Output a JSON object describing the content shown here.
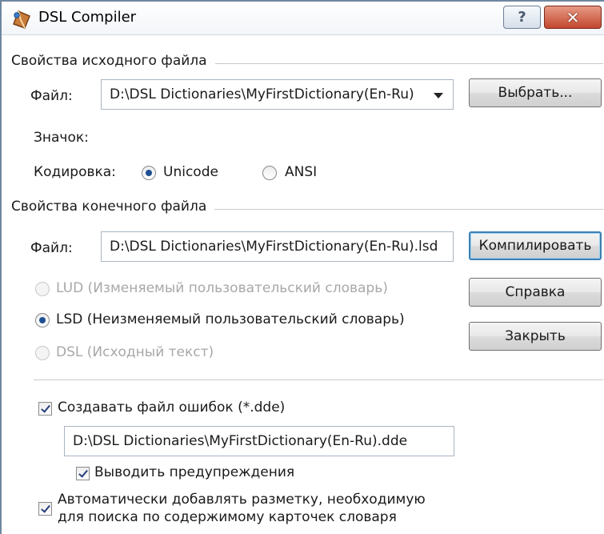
{
  "window": {
    "title": "DSL Compiler",
    "help_label": "?",
    "close_label": "✕"
  },
  "source": {
    "group_title": "Свойства исходного файла",
    "file_label": "Файл:",
    "file_value": "D:\\DSL Dictionaries\\MyFirstDictionary(En-Ru)",
    "browse_label": "Выбрать...",
    "icon_label": "Значок:",
    "encoding_label": "Кодировка:",
    "encoding_options": [
      "Unicode",
      "ANSI"
    ],
    "encoding_selected": "Unicode"
  },
  "target": {
    "group_title": "Свойства конечного файла",
    "file_label": "Файл:",
    "file_value": "D:\\DSL Dictionaries\\MyFirstDictionary(En-Ru).lsd",
    "formats": [
      {
        "label": "LUD (Изменяемый пользовательский словарь)",
        "enabled": false,
        "checked": false
      },
      {
        "label": "LSD (Неизменяемый пользовательский словарь)",
        "enabled": true,
        "checked": true
      },
      {
        "label": "DSL (Исходный текст)",
        "enabled": false,
        "checked": false
      }
    ]
  },
  "buttons": {
    "compile": "Компилировать",
    "help": "Справка",
    "close": "Закрыть"
  },
  "errors": {
    "create_label": "Создавать файл ошибок (*.dde)",
    "create_checked": true,
    "file_value": "D:\\DSL Dictionaries\\MyFirstDictionary(En-Ru).dde",
    "warnings_label": "Выводить предупреждения",
    "warnings_checked": true,
    "markup_label_line1": "Автоматически добавлять разметку, необходимую",
    "markup_label_line2": "для поиска по содержимому карточек словаря",
    "markup_checked": true
  },
  "colors": {
    "default_button_border": "#3c7fb1",
    "close_button": "#c3462e",
    "disabled_text": "#a8a8a8"
  }
}
